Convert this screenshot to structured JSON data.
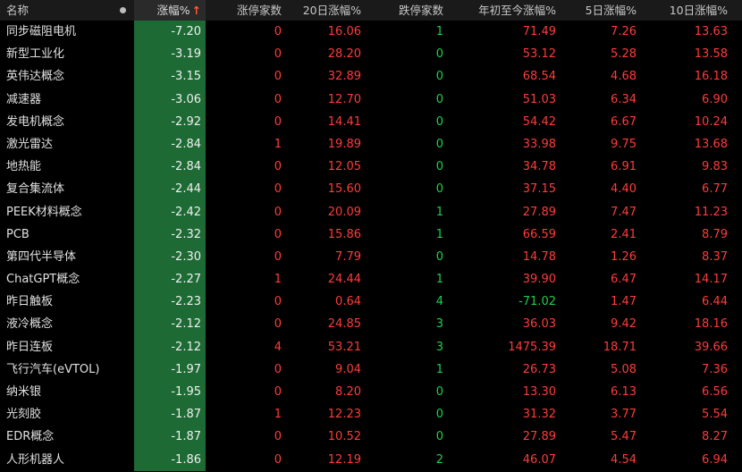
{
  "columns": {
    "name": "名称",
    "change": "涨幅%",
    "change_sort_icon": "arrow-up-icon",
    "limit_up_count": "涨停家数",
    "change_20d": "20日涨幅%",
    "limit_down_count": "跌停家数",
    "change_ytd": "年初至今涨幅%",
    "change_5d": "5日涨幅%",
    "change_10d": "10日涨幅%"
  },
  "colors": {
    "up": "#ff3b3b",
    "down": "#1fce4c",
    "change_cell_bg": "#1d6a34"
  },
  "rows": [
    {
      "name": "同步磁阻电机",
      "change": "-7.20",
      "limit_up": "0",
      "d20": "16.06",
      "limit_down": "1",
      "ytd": "71.49",
      "d5": "7.26",
      "d10": "13.63"
    },
    {
      "name": "新型工业化",
      "change": "-3.19",
      "limit_up": "0",
      "d20": "28.20",
      "limit_down": "0",
      "ytd": "53.12",
      "d5": "5.28",
      "d10": "13.58"
    },
    {
      "name": "英伟达概念",
      "change": "-3.15",
      "limit_up": "0",
      "d20": "32.89",
      "limit_down": "0",
      "ytd": "68.54",
      "d5": "4.68",
      "d10": "16.18"
    },
    {
      "name": "减速器",
      "change": "-3.06",
      "limit_up": "0",
      "d20": "12.70",
      "limit_down": "0",
      "ytd": "51.03",
      "d5": "6.34",
      "d10": "6.90"
    },
    {
      "name": "发电机概念",
      "change": "-2.92",
      "limit_up": "0",
      "d20": "14.41",
      "limit_down": "0",
      "ytd": "54.42",
      "d5": "6.67",
      "d10": "10.24"
    },
    {
      "name": "激光雷达",
      "change": "-2.84",
      "limit_up": "1",
      "d20": "19.89",
      "limit_down": "0",
      "ytd": "33.98",
      "d5": "9.75",
      "d10": "13.68"
    },
    {
      "name": "地热能",
      "change": "-2.84",
      "limit_up": "0",
      "d20": "12.05",
      "limit_down": "0",
      "ytd": "34.78",
      "d5": "6.91",
      "d10": "9.83"
    },
    {
      "name": "复合集流体",
      "change": "-2.44",
      "limit_up": "0",
      "d20": "15.60",
      "limit_down": "0",
      "ytd": "37.15",
      "d5": "4.40",
      "d10": "6.77"
    },
    {
      "name": "PEEK材料概念",
      "change": "-2.42",
      "limit_up": "0",
      "d20": "20.09",
      "limit_down": "1",
      "ytd": "27.89",
      "d5": "7.47",
      "d10": "11.23"
    },
    {
      "name": "PCB",
      "change": "-2.32",
      "limit_up": "0",
      "d20": "15.86",
      "limit_down": "1",
      "ytd": "66.59",
      "d5": "2.41",
      "d10": "8.79"
    },
    {
      "name": "第四代半导体",
      "change": "-2.30",
      "limit_up": "0",
      "d20": "7.79",
      "limit_down": "0",
      "ytd": "14.78",
      "d5": "1.26",
      "d10": "8.37"
    },
    {
      "name": "ChatGPT概念",
      "change": "-2.27",
      "limit_up": "1",
      "d20": "24.44",
      "limit_down": "1",
      "ytd": "39.90",
      "d5": "6.47",
      "d10": "14.17"
    },
    {
      "name": "昨日触板",
      "change": "-2.23",
      "limit_up": "0",
      "d20": "0.64",
      "limit_down": "4",
      "ytd": "-71.02",
      "d5": "1.47",
      "d10": "6.44"
    },
    {
      "name": "液冷概念",
      "change": "-2.12",
      "limit_up": "0",
      "d20": "24.85",
      "limit_down": "3",
      "ytd": "36.03",
      "d5": "9.42",
      "d10": "18.16"
    },
    {
      "name": "昨日连板",
      "change": "-2.12",
      "limit_up": "4",
      "d20": "53.21",
      "limit_down": "3",
      "ytd": "1475.39",
      "d5": "18.71",
      "d10": "39.66"
    },
    {
      "name": "飞行汽车(eVTOL)",
      "change": "-1.97",
      "limit_up": "0",
      "d20": "9.04",
      "limit_down": "1",
      "ytd": "26.73",
      "d5": "5.08",
      "d10": "7.36"
    },
    {
      "name": "纳米银",
      "change": "-1.95",
      "limit_up": "0",
      "d20": "8.20",
      "limit_down": "0",
      "ytd": "13.30",
      "d5": "6.13",
      "d10": "6.56"
    },
    {
      "name": "光刻胶",
      "change": "-1.87",
      "limit_up": "1",
      "d20": "12.23",
      "limit_down": "0",
      "ytd": "31.32",
      "d5": "3.77",
      "d10": "5.54"
    },
    {
      "name": "EDR概念",
      "change": "-1.87",
      "limit_up": "0",
      "d20": "10.52",
      "limit_down": "0",
      "ytd": "27.89",
      "d5": "5.47",
      "d10": "8.27"
    },
    {
      "name": "人形机器人",
      "change": "-1.86",
      "limit_up": "0",
      "d20": "12.19",
      "limit_down": "2",
      "ytd": "46.07",
      "d5": "4.54",
      "d10": "6.94"
    }
  ]
}
